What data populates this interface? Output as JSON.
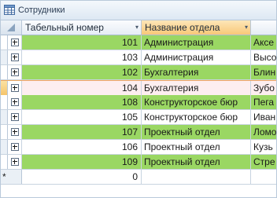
{
  "window": {
    "title": "Сотрудники"
  },
  "columns": [
    {
      "label": "Табельный номер",
      "sort": "▾"
    },
    {
      "label": "Название отдела",
      "sort": "▾"
    },
    {
      "label": ""
    }
  ],
  "rows": [
    {
      "id": "101",
      "dept": "Администрация",
      "name": "Аксе"
    },
    {
      "id": "103",
      "dept": "Администрация",
      "name": "Высо"
    },
    {
      "id": "102",
      "dept": "Бухгалтерия",
      "name": "Блин"
    },
    {
      "id": "104",
      "dept": "Бухгалтерия",
      "name": "Зубо"
    },
    {
      "id": "108",
      "dept": "Конструкторское бюр",
      "name": "Пега"
    },
    {
      "id": "105",
      "dept": "Конструкторское бюр",
      "name": "Иван"
    },
    {
      "id": "107",
      "dept": "Проектный отдел",
      "name": "Ломо"
    },
    {
      "id": "106",
      "dept": "Проектный отдел",
      "name": "Кузь"
    },
    {
      "id": "109",
      "dept": "Проектный отдел",
      "name": "Стре"
    }
  ],
  "new_row": {
    "marker": "*",
    "id": "0"
  },
  "colors": {
    "alt_row": "#9ad763",
    "current_row": "#fdeef0",
    "header_active": "#f8c878"
  }
}
